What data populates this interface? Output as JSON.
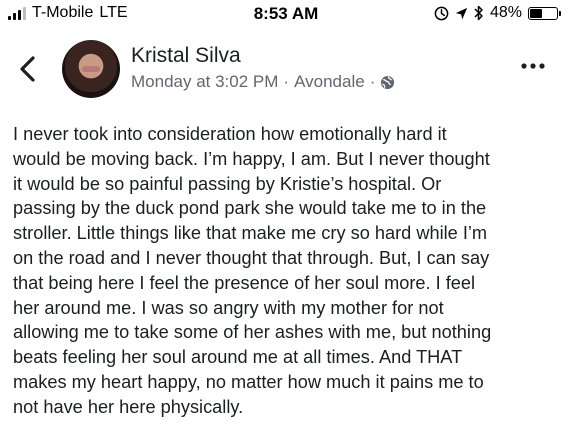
{
  "status_bar": {
    "carrier": "T-Mobile",
    "network": "LTE",
    "time": "8:53 AM",
    "battery_percent": "48%",
    "battery_level": 0.48,
    "icons": [
      "signal-icon",
      "alarm-icon",
      "location-arrow-icon",
      "bluetooth-icon",
      "battery-icon"
    ]
  },
  "post": {
    "author": "Kristal Silva",
    "timestamp": "Monday at 3:02 PM",
    "separator": "·",
    "location": "Avondale",
    "privacy_icon": "globe-icon",
    "lines": [
      "I never took into consideration how emotionally hard it",
      "would be moving back. I’m happy, I am. But I never thought",
      "it would be so painful passing by Kristie’s hospital. Or",
      "passing by the duck pond park she would take me to in the",
      "stroller. Little things like that make me cry so hard while I’m",
      "on the road and I never thought that through. But, I can say",
      "that being here I feel the presence of her soul more. I feel",
      "her around me. I was so angry with my mother for not",
      "allowing me to take some of her ashes with me, but nothing",
      "beats feeling her soul around me at all times. And THAT",
      "makes my heart happy, no matter how much it pains me to",
      "not have her here physically."
    ]
  },
  "colors": {
    "text": "#1c1e21",
    "meta": "#606770"
  }
}
